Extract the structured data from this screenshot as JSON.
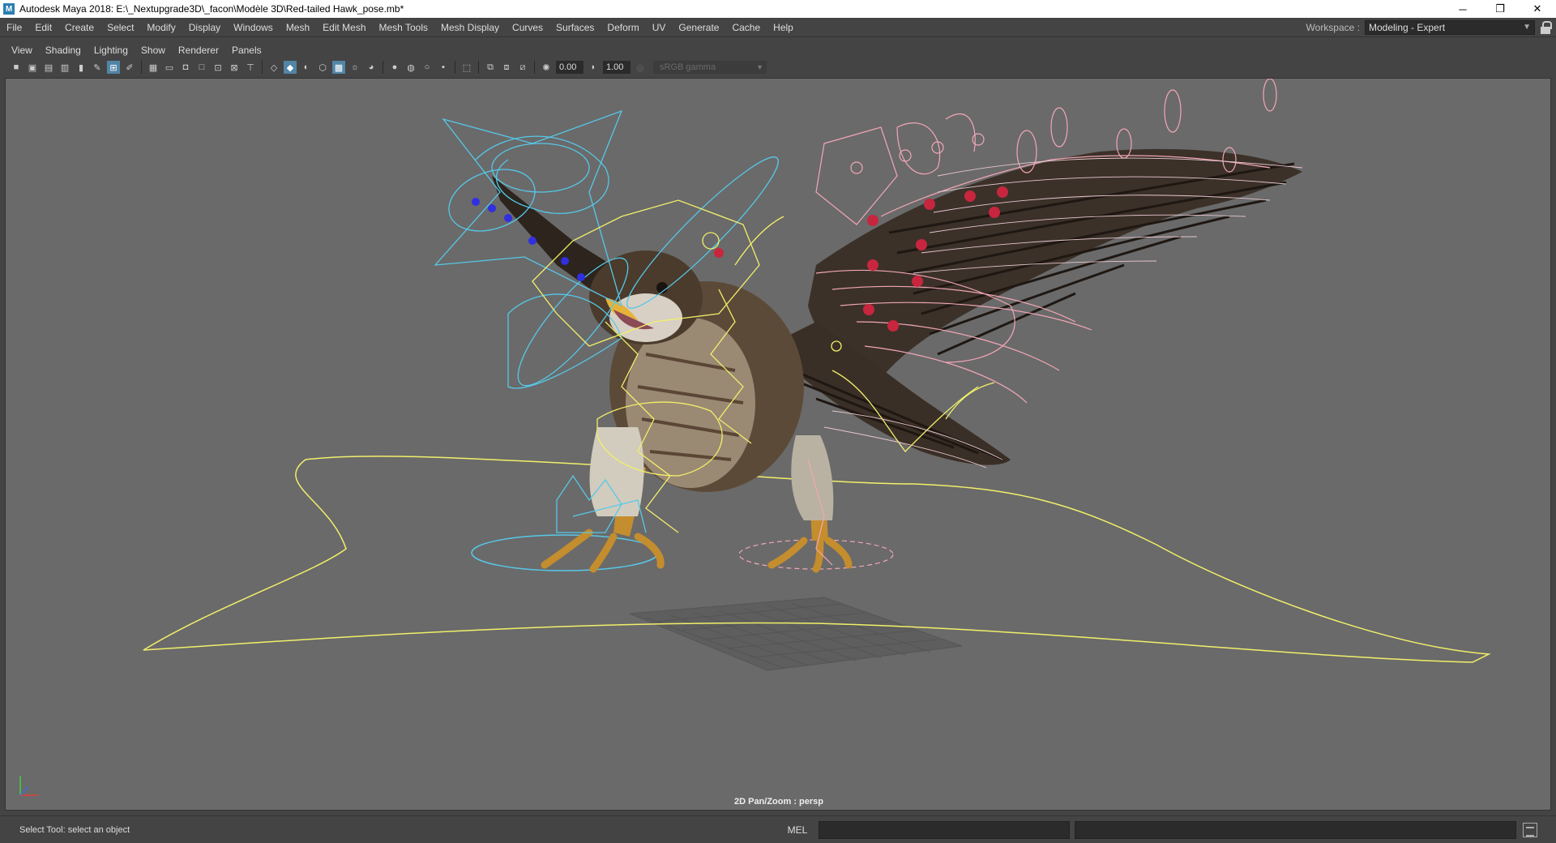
{
  "window": {
    "title": "Autodesk Maya 2018: E:\\_Nextupgrade3D\\_facon\\Modèle 3D\\Red-tailed Hawk_pose.mb*",
    "minimize": "─",
    "restore": "❐",
    "close": "✕"
  },
  "menubar": {
    "items": [
      "File",
      "Edit",
      "Create",
      "Select",
      "Modify",
      "Display",
      "Windows",
      "Mesh",
      "Edit Mesh",
      "Mesh Tools",
      "Mesh Display",
      "Curves",
      "Surfaces",
      "Deform",
      "UV",
      "Generate",
      "Cache",
      "Help"
    ]
  },
  "workspace": {
    "label": "Workspace :",
    "value": "Modeling - Expert"
  },
  "panel_menu": {
    "items": [
      "View",
      "Shading",
      "Lighting",
      "Show",
      "Renderer",
      "Panels"
    ]
  },
  "panel_toolbar": {
    "exposure": "0.00",
    "gamma": "1.00",
    "color_space": "sRGB gamma"
  },
  "viewport": {
    "hud_label": "2D Pan/Zoom : persp",
    "background": "#6a6a6a"
  },
  "statusbar": {
    "help_line": "Select Tool: select an object",
    "mel_label": "MEL"
  },
  "colors": {
    "ctrl_yellow": "#f2ef6a",
    "ctrl_cyan": "#56c8e8",
    "ctrl_blue": "#3030e0",
    "ctrl_pink": "#f2a6b6",
    "ctrl_red": "#c8263e",
    "accent": "#5285a6"
  }
}
